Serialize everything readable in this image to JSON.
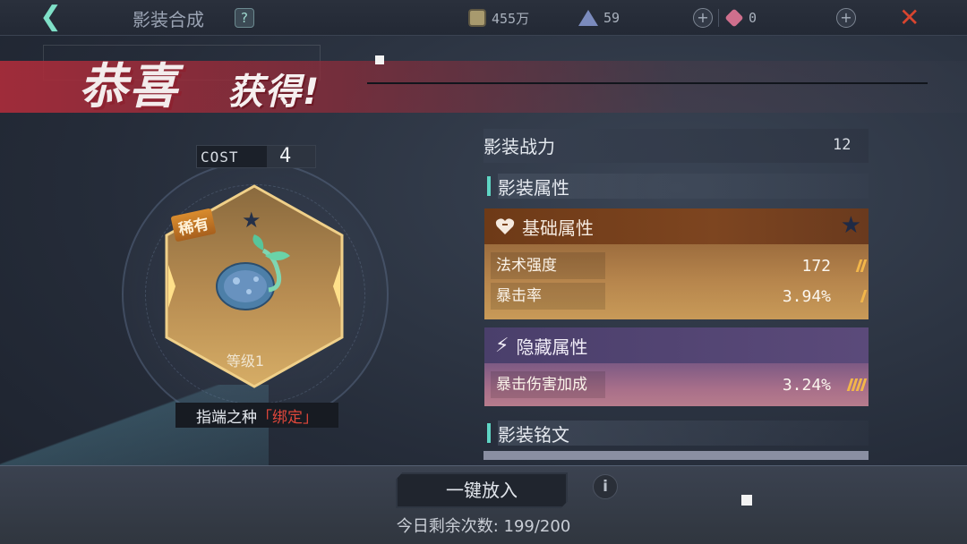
{
  "topbar": {
    "back_icon": "back-arrow-icon",
    "title": "影装合成",
    "help_icon": "question-icon",
    "resources": [
      {
        "icon": "coin-icon",
        "value": "455万"
      },
      {
        "icon": "pyramid-icon",
        "value": "59"
      },
      {
        "icon": "diamond-icon",
        "value": "0"
      }
    ],
    "close_icon": "close-x-icon"
  },
  "banner": {
    "congrats": "恭喜",
    "obtained": "获得!"
  },
  "item": {
    "cost_label": "COST",
    "cost_value": "4",
    "rarity": "稀有",
    "level": "等级1",
    "name": "指端之种",
    "bind_tag": "「绑定」"
  },
  "stats": {
    "power_label": "影装战力",
    "power_value": "12",
    "attributes_title": "影装属性",
    "base": {
      "title": "基础属性",
      "rows": [
        {
          "label": "法术强度",
          "value": "172",
          "bars": 2
        },
        {
          "label": "暴击率",
          "value": "3.94%",
          "bars": 1
        }
      ]
    },
    "hidden": {
      "title": "隐藏属性",
      "rows": [
        {
          "label": "暴击伤害加成",
          "value": "3.24%",
          "bars": 4
        }
      ]
    },
    "inscription_title": "影装铭文"
  },
  "bottom": {
    "put_in_button": "一键放入",
    "info_icon": "info-icon",
    "remaining": "今日剩余次数: 199/200"
  },
  "colors": {
    "accent_teal": "#5fd5c4",
    "banner_red": "#ad2c3a",
    "bind_red": "#e0473b",
    "base_brown": "#7d4520",
    "hidden_purple": "#5b4a7a"
  }
}
